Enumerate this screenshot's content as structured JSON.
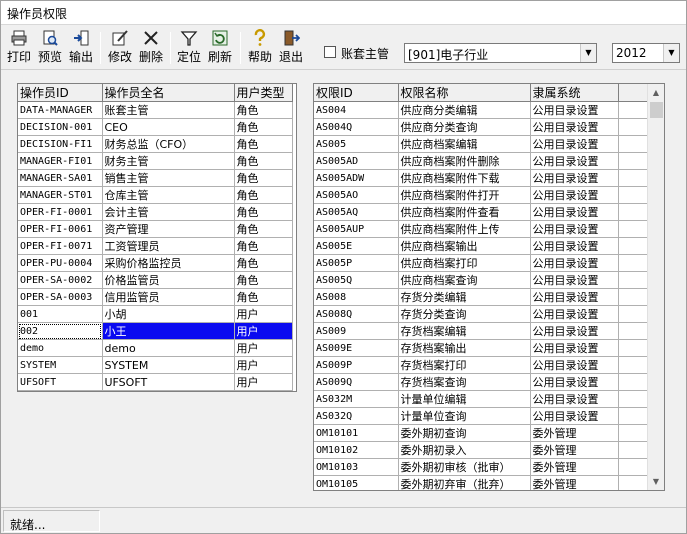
{
  "window": {
    "title": "操作员权限"
  },
  "toolbar": {
    "buttons": [
      {
        "label": "打印",
        "icon": "printer-icon"
      },
      {
        "label": "预览",
        "icon": "preview-icon"
      },
      {
        "label": "输出",
        "icon": "export-icon"
      },
      {
        "label": "修改",
        "icon": "edit-icon"
      },
      {
        "label": "删除",
        "icon": "delete-icon"
      },
      {
        "label": "定位",
        "icon": "filter-icon"
      },
      {
        "label": "刷新",
        "icon": "refresh-icon"
      },
      {
        "label": "帮助",
        "icon": "help-icon"
      },
      {
        "label": "退出",
        "icon": "exit-icon"
      }
    ],
    "checkbox_label": "账套主管",
    "account_combo": "[901]电子行业",
    "year_combo": "2012"
  },
  "operators": {
    "columns": [
      "操作员ID",
      "操作员全名",
      "用户类型"
    ],
    "rows": [
      [
        "DATA-MANAGER",
        "账套主管",
        "角色"
      ],
      [
        "DECISION-001",
        "CEO",
        "角色"
      ],
      [
        "DECISION-FI1",
        "财务总监（CFO）",
        "角色"
      ],
      [
        "MANAGER-FI01",
        "财务主管",
        "角色"
      ],
      [
        "MANAGER-SA01",
        "销售主管",
        "角色"
      ],
      [
        "MANAGER-ST01",
        "仓库主管",
        "角色"
      ],
      [
        "OPER-FI-0001",
        "会计主管",
        "角色"
      ],
      [
        "OPER-FI-0061",
        "资产管理",
        "角色"
      ],
      [
        "OPER-FI-0071",
        "工资管理员",
        "角色"
      ],
      [
        "OPER-PU-0004",
        "采购价格监控员",
        "角色"
      ],
      [
        "OPER-SA-0002",
        "价格监管员",
        "角色"
      ],
      [
        "OPER-SA-0003",
        "信用监管员",
        "角色"
      ],
      [
        "001",
        "小胡",
        "用户"
      ],
      [
        "002",
        "小王",
        "用户"
      ],
      [
        "demo",
        "demo",
        "用户"
      ],
      [
        "SYSTEM",
        "SYSTEM",
        "用户"
      ],
      [
        "UFSOFT",
        "UFSOFT",
        "用户"
      ]
    ],
    "selected_row": 13
  },
  "permissions": {
    "columns": [
      "权限ID",
      "权限名称",
      "隶属系统"
    ],
    "rows": [
      [
        "AS004",
        "供应商分类编辑",
        "公用目录设置"
      ],
      [
        "AS004Q",
        "供应商分类查询",
        "公用目录设置"
      ],
      [
        "AS005",
        "供应商档案编辑",
        "公用目录设置"
      ],
      [
        "AS005AD",
        "供应商档案附件删除",
        "公用目录设置"
      ],
      [
        "AS005ADW",
        "供应商档案附件下载",
        "公用目录设置"
      ],
      [
        "AS005AO",
        "供应商档案附件打开",
        "公用目录设置"
      ],
      [
        "AS005AQ",
        "供应商档案附件查看",
        "公用目录设置"
      ],
      [
        "AS005AUP",
        "供应商档案附件上传",
        "公用目录设置"
      ],
      [
        "AS005E",
        "供应商档案输出",
        "公用目录设置"
      ],
      [
        "AS005P",
        "供应商档案打印",
        "公用目录设置"
      ],
      [
        "AS005Q",
        "供应商档案查询",
        "公用目录设置"
      ],
      [
        "AS008",
        "存货分类编辑",
        "公用目录设置"
      ],
      [
        "AS008Q",
        "存货分类查询",
        "公用目录设置"
      ],
      [
        "AS009",
        "存货档案编辑",
        "公用目录设置"
      ],
      [
        "AS009E",
        "存货档案输出",
        "公用目录设置"
      ],
      [
        "AS009P",
        "存货档案打印",
        "公用目录设置"
      ],
      [
        "AS009Q",
        "存货档案查询",
        "公用目录设置"
      ],
      [
        "AS032M",
        "计量单位编辑",
        "公用目录设置"
      ],
      [
        "AS032Q",
        "计量单位查询",
        "公用目录设置"
      ],
      [
        "OM10101",
        "委外期初查询",
        "委外管理"
      ],
      [
        "OM10102",
        "委外期初录入",
        "委外管理"
      ],
      [
        "OM10103",
        "委外期初审核（批审）",
        "委外管理"
      ],
      [
        "OM10105",
        "委外期初弃审（批弃）",
        "委外管理"
      ]
    ]
  },
  "status": {
    "text": "就绪..."
  }
}
